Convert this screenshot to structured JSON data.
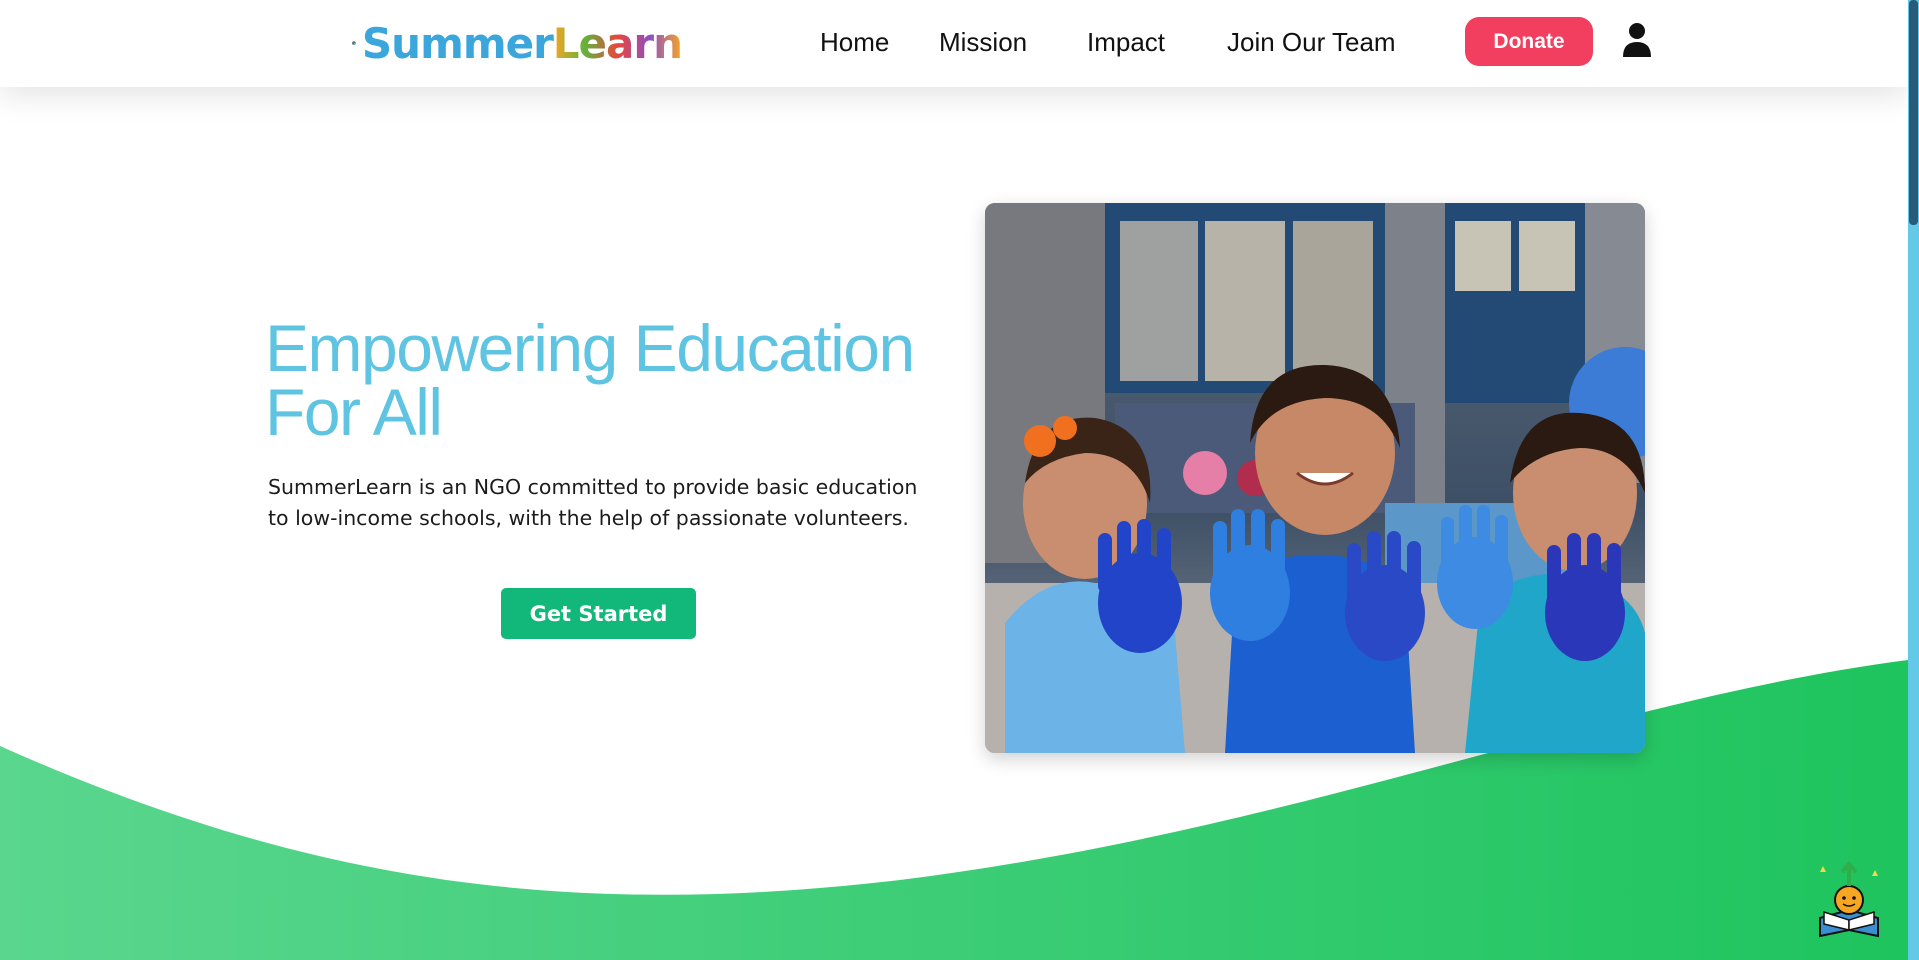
{
  "brand": {
    "name_part1": "Summer",
    "name_part2": "Learn",
    "colors": {
      "summer": [
        "#3aa6dc",
        "#3aa6dc",
        "#3aa6dc",
        "#3aa6dc",
        "#3aa6dc",
        "#3aa6dc"
      ],
      "learn": [
        "#f6a623",
        "#63b23a",
        "#e9463c",
        "#8d4fc3",
        "#f6a623"
      ]
    }
  },
  "nav": {
    "items": [
      {
        "label": "Home"
      },
      {
        "label": "Mission"
      },
      {
        "label": "Impact"
      },
      {
        "label": "Join Our Team"
      }
    ],
    "donate_label": "Donate",
    "user_icon": "user-icon"
  },
  "hero": {
    "title_line1": "Empowering Education",
    "title_line2": "For All",
    "description_line1": "SummerLearn is an NGO committed to provide basic education",
    "description_line2": "to low-income schools, with the help of passionate volunteers.",
    "cta_label": "Get Started"
  },
  "theme": {
    "title_color": "#5ec4e2",
    "cta_color": "#12b77a",
    "donate_color": "#f23f5f",
    "wave_color_start": "#5ad68e",
    "wave_color_end": "#1ec45e",
    "scrollbar_color": "#63c9e6"
  },
  "icons": {
    "logo": "book-sun-logo-icon",
    "mascot": "book-mascot-icon",
    "user": "user-icon"
  }
}
